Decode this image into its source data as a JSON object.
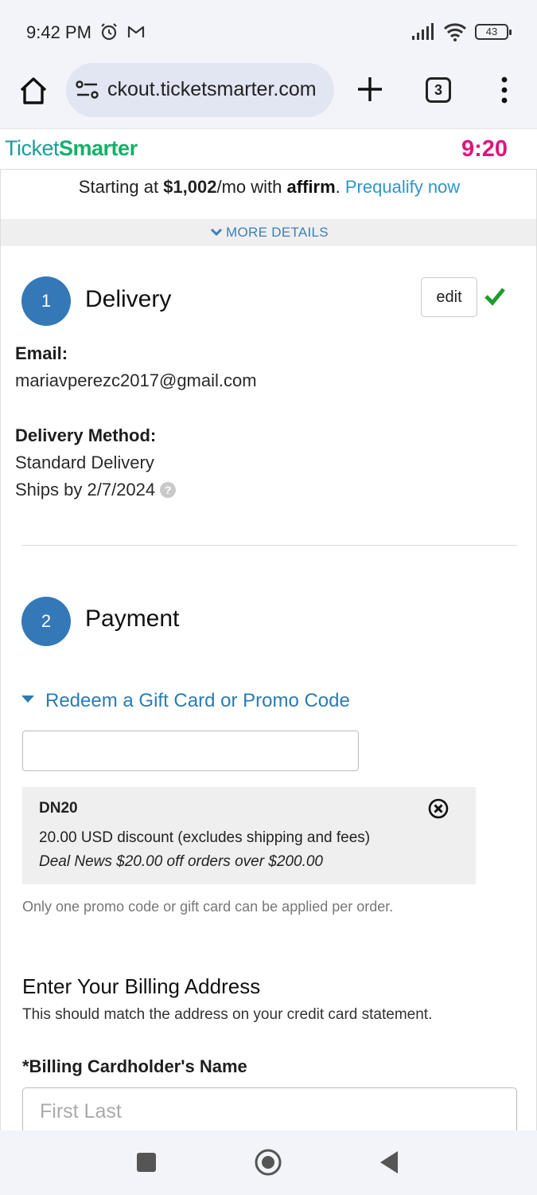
{
  "status_bar": {
    "time": "9:42 PM",
    "left_icons": [
      "alarm-icon",
      "gmail-icon"
    ],
    "right_icons": [
      "signal-icon",
      "wifi-icon",
      "battery-icon"
    ],
    "battery_level": "43"
  },
  "browser": {
    "url": "ckout.ticketsmarter.com",
    "tab_count": "3",
    "icons": [
      "home-icon",
      "site-settings-icon",
      "plus-icon",
      "tab-switcher-icon",
      "kebab-menu-icon"
    ]
  },
  "site": {
    "logo_part1": "Ticket",
    "logo_part2": "Smarter",
    "timer": "9:20"
  },
  "affirm": {
    "prefix": "Starting at ",
    "amount": "$1,002",
    "suffix": "/mo with ",
    "brand": "affirm",
    "period": ". ",
    "link": "Prequalify now"
  },
  "more_details": "MORE DETAILS",
  "delivery": {
    "step": "1",
    "title": "Delivery",
    "edit_label": "edit",
    "email_label": "Email:",
    "email_value": "mariavperezc2017@gmail.com",
    "method_label": "Delivery Method:",
    "method_value": "Standard Delivery",
    "ships_by": "Ships by 2/7/2024",
    "help_glyph": "?"
  },
  "payment": {
    "step": "2",
    "title": "Payment",
    "promo_toggle": "Redeem a Gift Card or Promo Code",
    "promo_input_value": "",
    "applied_promo": {
      "code": "DN20",
      "description": "20.00 USD discount (excludes shipping and fees)",
      "note": "Deal News $20.00 off orders over $200.00"
    },
    "promo_rule": "Only one promo code or gift card can be applied per order."
  },
  "billing": {
    "title": "Enter Your Billing Address",
    "subtitle": "This should match the address on your credit card statement.",
    "name_label": "*Billing Cardholder's Name",
    "name_placeholder": "First Last",
    "name_value": ""
  },
  "nav": {
    "icons": [
      "recents-square-icon",
      "home-circle-icon",
      "back-triangle-icon"
    ]
  },
  "colors": {
    "step_blue": "#3478b8",
    "link_blue": "#2f96c7",
    "timer_pink": "#e0157b",
    "check_green": "#1a9e2c",
    "logo_teal": "#1a9e9b",
    "logo_green": "#14b06a"
  }
}
